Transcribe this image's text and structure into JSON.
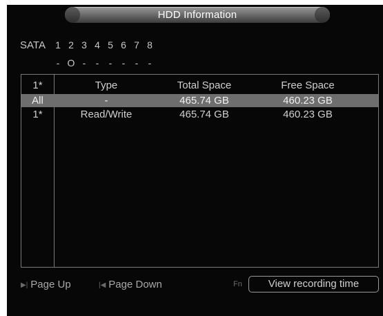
{
  "window": {
    "title": "HDD Information"
  },
  "sata": {
    "label": "SATA",
    "ports": [
      {
        "number": "1",
        "status": "-"
      },
      {
        "number": "2",
        "status": "O"
      },
      {
        "number": "3",
        "status": "-"
      },
      {
        "number": "4",
        "status": "-"
      },
      {
        "number": "5",
        "status": "-"
      },
      {
        "number": "6",
        "status": "-"
      },
      {
        "number": "7",
        "status": "-"
      },
      {
        "number": "8",
        "status": "-"
      }
    ]
  },
  "table": {
    "headers": {
      "disk": "1*",
      "type": "Type",
      "total": "Total Space",
      "free": "Free Space"
    },
    "rows": [
      {
        "disk": "All",
        "type": "-",
        "total": "465.74 GB",
        "free": "460.23 GB",
        "selected": true
      },
      {
        "disk": "1*",
        "type": "Read/Write",
        "total": "465.74 GB",
        "free": "460.23 GB",
        "selected": false
      }
    ]
  },
  "footer": {
    "page_up": "Page Up",
    "page_down": "Page Down",
    "fn_label": "Fn",
    "view_recording_time": "View recording time"
  },
  "colors": {
    "background": "#070707",
    "text": "#c8c8c8",
    "selected_row": "#6e6e6e",
    "border": "#7a7a7a"
  }
}
